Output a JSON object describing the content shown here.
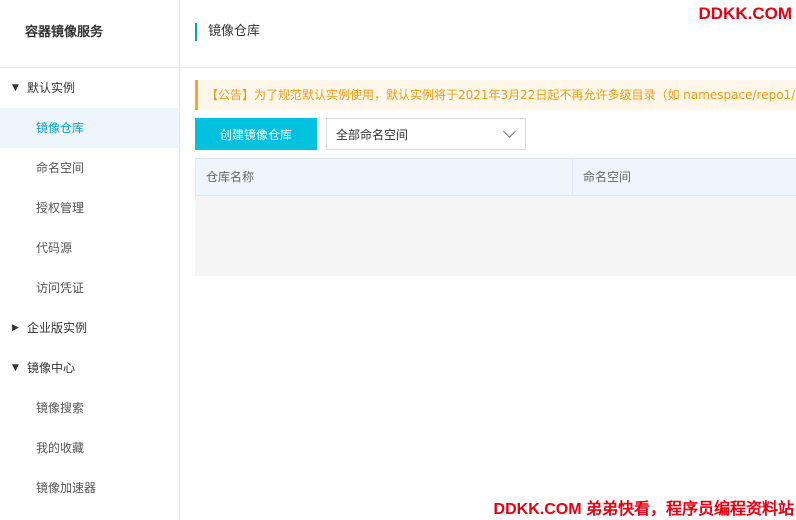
{
  "sidebar": {
    "title": "容器镜像服务",
    "groups": [
      {
        "label": "默认实例",
        "expanded": true,
        "items": [
          "镜像仓库",
          "命名空间",
          "授权管理",
          "代码源",
          "访问凭证"
        ]
      },
      {
        "label": "企业版实例",
        "expanded": false,
        "items": []
      },
      {
        "label": "镜像中心",
        "expanded": true,
        "items": [
          "镜像搜索",
          "我的收藏",
          "镜像加速器"
        ]
      }
    ],
    "active_item": "镜像仓库"
  },
  "header": {
    "title": "镜像仓库",
    "brand": "DDKK.COM"
  },
  "notice": {
    "text": "【公告】为了规范默认实例使用，默认实例将于2021年3月22日起不再允许多级目录（如 namespace/repo1/rep"
  },
  "toolbar": {
    "create_label": "创建镜像仓库",
    "namespace_select": "全部命名空间"
  },
  "table": {
    "columns": [
      "仓库名称",
      "命名空间"
    ],
    "rows": []
  },
  "footer": {
    "watermark": "DDKK.COM 弟弟快看，程序员编程资料站"
  },
  "colors": {
    "accent": "#00c1de",
    "active_text": "#00a2ca",
    "notice_text": "#f39c12",
    "brand": "#e60012"
  },
  "icons": {
    "expanded": "caret-down-icon",
    "collapsed": "caret-right-icon",
    "select": "chevron-down-icon"
  }
}
